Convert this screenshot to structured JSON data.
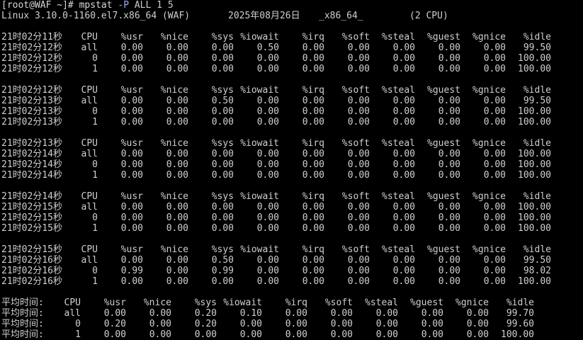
{
  "prompt": {
    "text": "[root@WAF ~]# mpstat ",
    "option": "-P",
    "args": " ALL 1 5"
  },
  "sysinfo": {
    "kernel": "Linux 3.10.0-1160.el7.x86_64 (WAF)",
    "date": "2025年08月26日",
    "arch": "_x86_64_",
    "cpus": "(2 CPU)"
  },
  "columns": [
    "CPU",
    "%usr",
    "%nice",
    "%sys",
    "%iowait",
    "%irq",
    "%soft",
    "%steal",
    "%guest",
    "%gnice",
    "%idle"
  ],
  "blocks": [
    {
      "header_time": "21时02分11秒",
      "rows": [
        {
          "time": "21时02分12秒",
          "values": [
            "all",
            "0.00",
            "0.00",
            "0.00",
            "0.50",
            "0.00",
            "0.00",
            "0.00",
            "0.00",
            "0.00",
            "99.50"
          ]
        },
        {
          "time": "21时02分12秒",
          "values": [
            "0",
            "0.00",
            "0.00",
            "0.00",
            "0.00",
            "0.00",
            "0.00",
            "0.00",
            "0.00",
            "0.00",
            "100.00"
          ]
        },
        {
          "time": "21时02分12秒",
          "values": [
            "1",
            "0.00",
            "0.00",
            "0.00",
            "0.00",
            "0.00",
            "0.00",
            "0.00",
            "0.00",
            "0.00",
            "100.00"
          ]
        }
      ]
    },
    {
      "header_time": "21时02分12秒",
      "rows": [
        {
          "time": "21时02分13秒",
          "values": [
            "all",
            "0.00",
            "0.00",
            "0.50",
            "0.00",
            "0.00",
            "0.00",
            "0.00",
            "0.00",
            "0.00",
            "99.50"
          ]
        },
        {
          "time": "21时02分13秒",
          "values": [
            "0",
            "0.00",
            "0.00",
            "0.00",
            "0.00",
            "0.00",
            "0.00",
            "0.00",
            "0.00",
            "0.00",
            "100.00"
          ]
        },
        {
          "time": "21时02分13秒",
          "values": [
            "1",
            "0.00",
            "0.00",
            "0.00",
            "0.00",
            "0.00",
            "0.00",
            "0.00",
            "0.00",
            "0.00",
            "100.00"
          ]
        }
      ]
    },
    {
      "header_time": "21时02分13秒",
      "rows": [
        {
          "time": "21时02分14秒",
          "values": [
            "all",
            "0.00",
            "0.00",
            "0.00",
            "0.00",
            "0.00",
            "0.00",
            "0.00",
            "0.00",
            "0.00",
            "100.00"
          ]
        },
        {
          "time": "21时02分14秒",
          "values": [
            "0",
            "0.00",
            "0.00",
            "0.00",
            "0.00",
            "0.00",
            "0.00",
            "0.00",
            "0.00",
            "0.00",
            "100.00"
          ]
        },
        {
          "time": "21时02分14秒",
          "values": [
            "1",
            "0.00",
            "0.00",
            "0.00",
            "0.00",
            "0.00",
            "0.00",
            "0.00",
            "0.00",
            "0.00",
            "100.00"
          ]
        }
      ]
    },
    {
      "header_time": "21时02分14秒",
      "rows": [
        {
          "time": "21时02分15秒",
          "values": [
            "all",
            "0.00",
            "0.00",
            "0.00",
            "0.00",
            "0.00",
            "0.00",
            "0.00",
            "0.00",
            "0.00",
            "100.00"
          ]
        },
        {
          "time": "21时02分15秒",
          "values": [
            "0",
            "0.00",
            "0.00",
            "0.00",
            "0.00",
            "0.00",
            "0.00",
            "0.00",
            "0.00",
            "0.00",
            "100.00"
          ]
        },
        {
          "time": "21时02分15秒",
          "values": [
            "1",
            "0.00",
            "0.00",
            "0.00",
            "0.00",
            "0.00",
            "0.00",
            "0.00",
            "0.00",
            "0.00",
            "100.00"
          ]
        }
      ]
    },
    {
      "header_time": "21时02分15秒",
      "rows": [
        {
          "time": "21时02分16秒",
          "values": [
            "all",
            "0.00",
            "0.00",
            "0.50",
            "0.00",
            "0.00",
            "0.00",
            "0.00",
            "0.00",
            "0.00",
            "99.50"
          ]
        },
        {
          "time": "21时02分16秒",
          "values": [
            "0",
            "0.99",
            "0.00",
            "0.99",
            "0.00",
            "0.00",
            "0.00",
            "0.00",
            "0.00",
            "0.00",
            "98.02"
          ]
        },
        {
          "time": "21时02分16秒",
          "values": [
            "1",
            "0.00",
            "0.00",
            "0.00",
            "0.00",
            "0.00",
            "0.00",
            "0.00",
            "0.00",
            "0.00",
            "100.00"
          ]
        }
      ]
    }
  ],
  "average": {
    "label": "平均时间:",
    "rows": [
      {
        "values": [
          "all",
          "0.00",
          "0.00",
          "0.20",
          "0.10",
          "0.00",
          "0.00",
          "0.00",
          "0.00",
          "0.00",
          "99.70"
        ]
      },
      {
        "values": [
          "0",
          "0.20",
          "0.00",
          "0.20",
          "0.00",
          "0.00",
          "0.00",
          "0.00",
          "0.00",
          "0.00",
          "99.60"
        ]
      },
      {
        "values": [
          "1",
          "0.00",
          "0.00",
          "0.00",
          "0.00",
          "0.00",
          "0.00",
          "0.00",
          "0.00",
          "0.00",
          "100.00"
        ]
      }
    ]
  }
}
